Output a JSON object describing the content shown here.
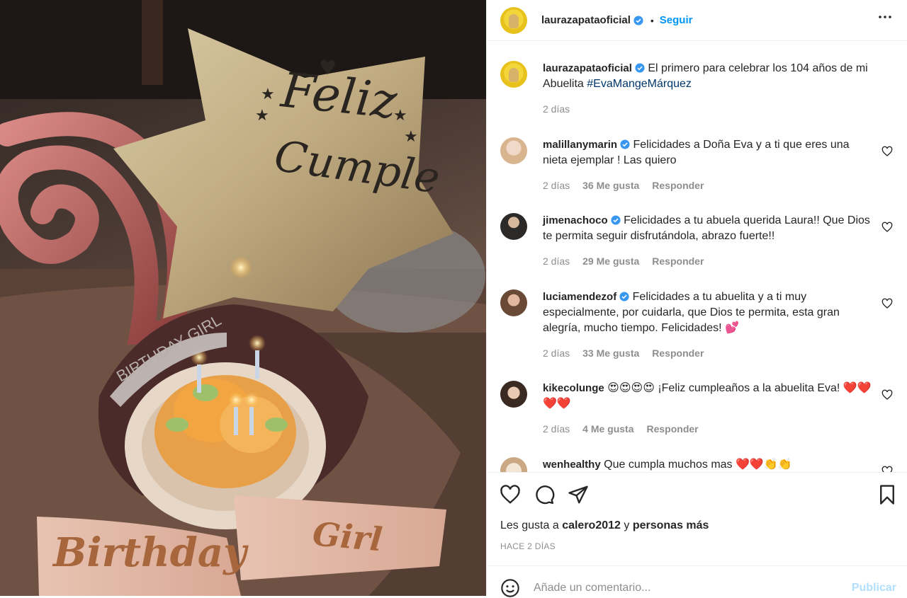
{
  "header": {
    "username": "laurazapataoficial",
    "dot": "•",
    "follow_label": "Seguir",
    "more_icon": "more-horizontal-icon"
  },
  "photo": {
    "balloon_line1": "Feliz",
    "balloon_line2": "Cumple",
    "tiara_text": "BIRTHDAY GIRL",
    "sash_word1": "Birthday",
    "sash_word2": "Girl"
  },
  "caption": {
    "username": "laurazapataoficial",
    "text": "El primero para celebrar los 104 años de mi Abuelita",
    "hashtag": "#EvaMangeMárquez",
    "time": "2 días"
  },
  "comments": [
    {
      "username": "malillanymarin",
      "text": "Felicidades a Doña Eva y a ti que eres una nieta ejemplar ! Las quiero",
      "time": "2 días",
      "likes": "36 Me gusta",
      "reply": "Responder"
    },
    {
      "username": "jimenachoco",
      "text": "Felicidades a tu abuela querida Laura!! Que Dios te permita seguir disfrutándola, abrazo fuerte!!",
      "time": "2 días",
      "likes": "29 Me gusta",
      "reply": "Responder"
    },
    {
      "username": "luciamendezof",
      "text": "Felicidades a tu abuelita y a ti muy especialmente, por cuidarla, que Dios te permita, esta gran alegría, mucho tiempo. Felicidades! 💕",
      "time": "2 días",
      "likes": "33 Me gusta",
      "reply": "Responder"
    },
    {
      "username": "kikecolunge",
      "text": "😍😍😍😍 ¡Feliz cumpleaños a la abuelita Eva! ❤️❤️❤️❤️",
      "time": "2 días",
      "likes": "4 Me gusta",
      "reply": "Responder"
    },
    {
      "username": "wenhealthy",
      "text": "Que cumpla muchos mas ❤️❤️👏👏"
    }
  ],
  "actions": {
    "likes_prefix": "Les gusta a",
    "liked_by": "calero2012",
    "conj": "y",
    "others": "personas más",
    "timestamp": "HACE 2 DÍAS"
  },
  "add_comment": {
    "placeholder": "Añade un comentario...",
    "publish_label": "Publicar"
  },
  "colors": {
    "accent": "#0095f6",
    "publish_disabled": "#b2dffc",
    "hashtag": "#00376b",
    "verified": "#3897f0"
  }
}
